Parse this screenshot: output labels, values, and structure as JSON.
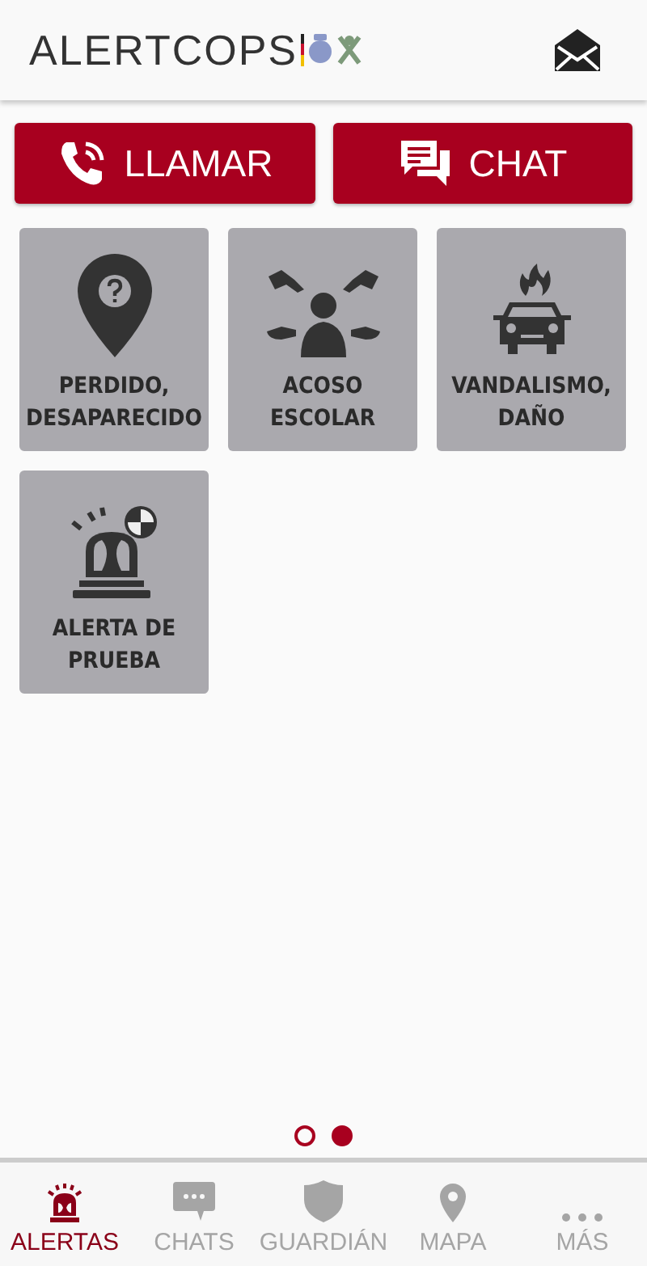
{
  "header": {
    "logo": "ALERTCOPS"
  },
  "actions": [
    {
      "kind": "call",
      "label": "LLAMAR"
    },
    {
      "kind": "chat",
      "label": "CHAT"
    }
  ],
  "alerts": [
    {
      "kind": "missing",
      "label": "PERDIDO, DESAPARECIDO"
    },
    {
      "kind": "bullying",
      "label": "ACOSO ESCOLAR"
    },
    {
      "kind": "vandalism",
      "label": "VANDALISMO, DAÑO"
    },
    {
      "kind": "test",
      "label": "ALERTA DE PRUEBA"
    }
  ],
  "pager": [
    {
      "selected": false
    },
    {
      "selected": true
    }
  ],
  "tabs": [
    {
      "kind": "alerts",
      "label": "ALERTAS",
      "selected": true
    },
    {
      "kind": "chats",
      "label": "CHATS",
      "selected": false
    },
    {
      "kind": "guardian",
      "label": "GUARDIÁN",
      "selected": false
    },
    {
      "kind": "map",
      "label": "MAPA",
      "selected": false
    },
    {
      "kind": "more",
      "label": "MÁS",
      "selected": false
    }
  ]
}
